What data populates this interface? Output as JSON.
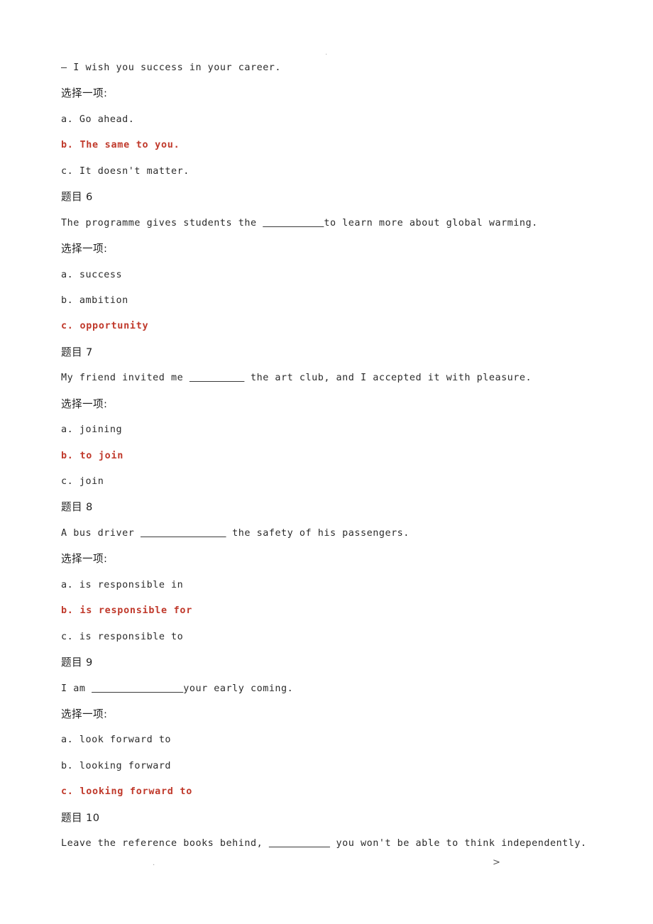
{
  "page": {
    "artifact_top": ".",
    "artifact_bottom_dot": ".",
    "artifact_bottom_arrow": ">"
  },
  "labels": {
    "choose_one": "选择一项:",
    "question_prefix": "题目"
  },
  "colors": {
    "correct_answer": "#c0392b",
    "body_text": "#2b2b2b",
    "background": "#ffffff"
  },
  "blocks": [
    {
      "id": "question-5-tail",
      "label": null,
      "stem": "— I wish you success in your career.",
      "choose_label": "选择一项:",
      "options": [
        {
          "letter": "a.",
          "text": "Go ahead.",
          "correct": false
        },
        {
          "letter": "b.",
          "text": "The same to you.",
          "correct": true
        },
        {
          "letter": "c.",
          "text": "It doesn't matter.",
          "correct": false
        }
      ]
    },
    {
      "id": "question-6",
      "label": "题目 6",
      "stem_before": "The programme gives students the ",
      "stem_blank": "__________",
      "stem_after": "to learn more about global warming.",
      "choose_label": "选择一项:",
      "options": [
        {
          "letter": "a.",
          "text": "success",
          "correct": false
        },
        {
          "letter": "b.",
          "text": "ambition",
          "correct": false
        },
        {
          "letter": "c.",
          "text": "opportunity",
          "correct": true
        }
      ]
    },
    {
      "id": "question-7",
      "label": "题目 7",
      "stem_before": "My friend invited me ",
      "stem_blank": "_________",
      "stem_after": " the art club, and I accepted it with pleasure.",
      "choose_label": "选择一项:",
      "options": [
        {
          "letter": "a.",
          "text": "joining",
          "correct": false
        },
        {
          "letter": "b.",
          "text": "to join",
          "correct": true
        },
        {
          "letter": "c.",
          "text": "join",
          "correct": false
        }
      ]
    },
    {
      "id": "question-8",
      "label": "题目 8",
      "stem_before": "A bus driver ",
      "stem_blank": "______________",
      "stem_after": " the safety of his passengers.",
      "choose_label": "选择一项:",
      "options": [
        {
          "letter": "a.",
          "text": "is responsible in",
          "correct": false
        },
        {
          "letter": "b.",
          "text": "is responsible for",
          "correct": true
        },
        {
          "letter": "c.",
          "text": "is responsible to",
          "correct": false
        }
      ]
    },
    {
      "id": "question-9",
      "label": "题目 9",
      "stem_before": "I am ",
      "stem_blank": "_______________",
      "stem_after": "your early coming.",
      "choose_label": "选择一项:",
      "options": [
        {
          "letter": "a.",
          "text": "look forward to",
          "correct": false
        },
        {
          "letter": "b.",
          "text": "looking forward",
          "correct": false
        },
        {
          "letter": "c.",
          "text": "looking forward to",
          "correct": true
        }
      ]
    },
    {
      "id": "question-10",
      "label": "题目 10",
      "stem_before": "Leave the reference books behind, ",
      "stem_blank": "__________",
      "stem_after": " you won't be able to think independently.",
      "choose_label": null,
      "options": []
    }
  ]
}
